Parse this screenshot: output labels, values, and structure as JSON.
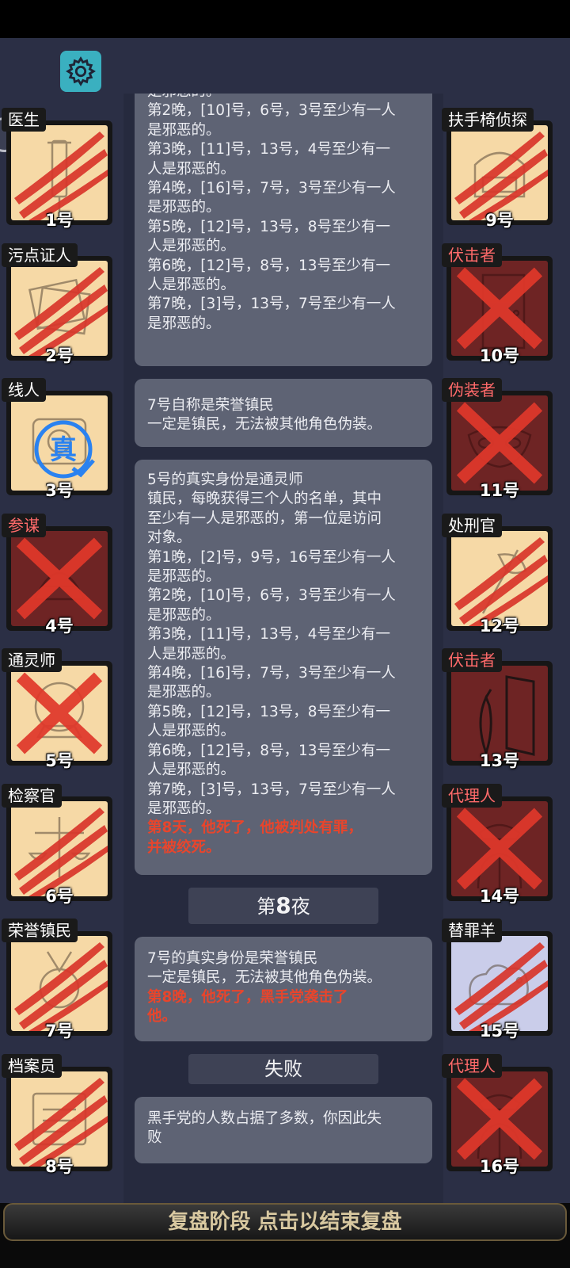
{
  "colors": {
    "background": "#2b2f45",
    "card": "#5e6374",
    "highlight_red": "#e8452c",
    "good_tile": "#f6d9a6",
    "evil_tile": "#6e2424",
    "gear_button": "#3ab0c0"
  },
  "gear_icon": "gear-icon",
  "players_left": [
    {
      "role": "医生",
      "num": "1号",
      "team": "good",
      "mark": "slash",
      "icon": "syringe-icon"
    },
    {
      "role": "污点证人",
      "num": "2号",
      "team": "good",
      "mark": "slash",
      "icon": "documents-icon"
    },
    {
      "role": "线人",
      "num": "3号",
      "team": "good",
      "mark": "truth",
      "icon": "informant-icon",
      "badge": "真"
    },
    {
      "role": "参谋",
      "num": "4号",
      "team": "evil",
      "mark": "x",
      "icon": "strategist-icon"
    },
    {
      "role": "通灵师",
      "num": "5号",
      "team": "good",
      "mark": "x",
      "icon": "crystal-ball-icon"
    },
    {
      "role": "检察官",
      "num": "6号",
      "team": "good",
      "mark": "slash",
      "icon": "scales-icon"
    },
    {
      "role": "荣誉镇民",
      "num": "7号",
      "team": "good",
      "mark": "slash",
      "icon": "medal-icon"
    },
    {
      "role": "档案员",
      "num": "8号",
      "team": "good",
      "mark": "slash",
      "icon": "archive-icon"
    }
  ],
  "players_right": [
    {
      "role": "扶手椅侦探",
      "num": "9号",
      "team": "good",
      "mark": "slash",
      "icon": "armchair-icon"
    },
    {
      "role": "伏击者",
      "num": "10号",
      "team": "evil",
      "mark": "x",
      "icon": "door-icon"
    },
    {
      "role": "伪装者",
      "num": "11号",
      "team": "evil",
      "mark": "x",
      "icon": "mask-icon"
    },
    {
      "role": "处刑官",
      "num": "12号",
      "team": "good",
      "mark": "slash",
      "icon": "axe-icon"
    },
    {
      "role": "伏击者",
      "num": "13号",
      "team": "evil",
      "mark": "none",
      "icon": "door-knife-icon"
    },
    {
      "role": "代理人",
      "num": "14号",
      "team": "evil",
      "mark": "x",
      "icon": "agent-icon"
    },
    {
      "role": "替罪羊",
      "num": "15号",
      "team": "lav",
      "mark": "slash",
      "icon": "sheep-icon"
    },
    {
      "role": "代理人",
      "num": "16号",
      "team": "evil",
      "mark": "x",
      "icon": "agent-icon"
    }
  ],
  "log": {
    "card1": [
      "是邪恶的。",
      "第2晚，[10]号，6号，3号至少有一人",
      "是邪恶的。",
      "第3晚，[11]号，13号，4号至少有一",
      "人是邪恶的。",
      "第4晚，[16]号，7号，3号至少有一人",
      "是邪恶的。",
      "第5晚，[12]号，13号，8号至少有一",
      "人是邪恶的。",
      "第6晚，[12]号，8号，13号至少有一",
      "人是邪恶的。",
      "第7晚，[3]号，13号，7号至少有一人",
      "是邪恶的。"
    ],
    "card2": [
      "7号自称是荣誉镇民",
      "一定是镇民，无法被其他角色伪装。"
    ],
    "card3": [
      "5号的真实身份是通灵师",
      "镇民，每晚获得三个人的名单，其中",
      "至少有一人是邪恶的，第一位是访问",
      "对象。",
      "第1晚，[2]号，9号，16号至少有一人",
      "是邪恶的。",
      "第2晚，[10]号，6号，3号至少有一人",
      "是邪恶的。",
      "第3晚，[11]号，13号，4号至少有一",
      "人是邪恶的。",
      "第4晚，[16]号，7号，3号至少有一人",
      "是邪恶的。",
      "第5晚，[12]号，13号，8号至少有一",
      "人是邪恶的。",
      "第6晚，[12]号，8号，13号至少有一",
      "人是邪恶的。",
      "第7晚，[3]号，13号，7号至少有一人",
      "是邪恶的。"
    ],
    "card3_red": [
      "第8天，他死了，他被判处有罪，",
      "并被绞死。"
    ],
    "night_header_pre": "第",
    "night_header_num": "8",
    "night_header_post": "夜",
    "card4": [
      "7号的真实身份是荣誉镇民",
      "一定是镇民，无法被其他角色伪装。"
    ],
    "card4_red": [
      "第8晚，他死了，黑手党袭击了",
      "他。"
    ],
    "fail_header": "失败",
    "card5": [
      "黑手党的人数占据了多数，你因此失",
      "败"
    ]
  },
  "end_button": "复盘阶段 点击以结束复盘"
}
